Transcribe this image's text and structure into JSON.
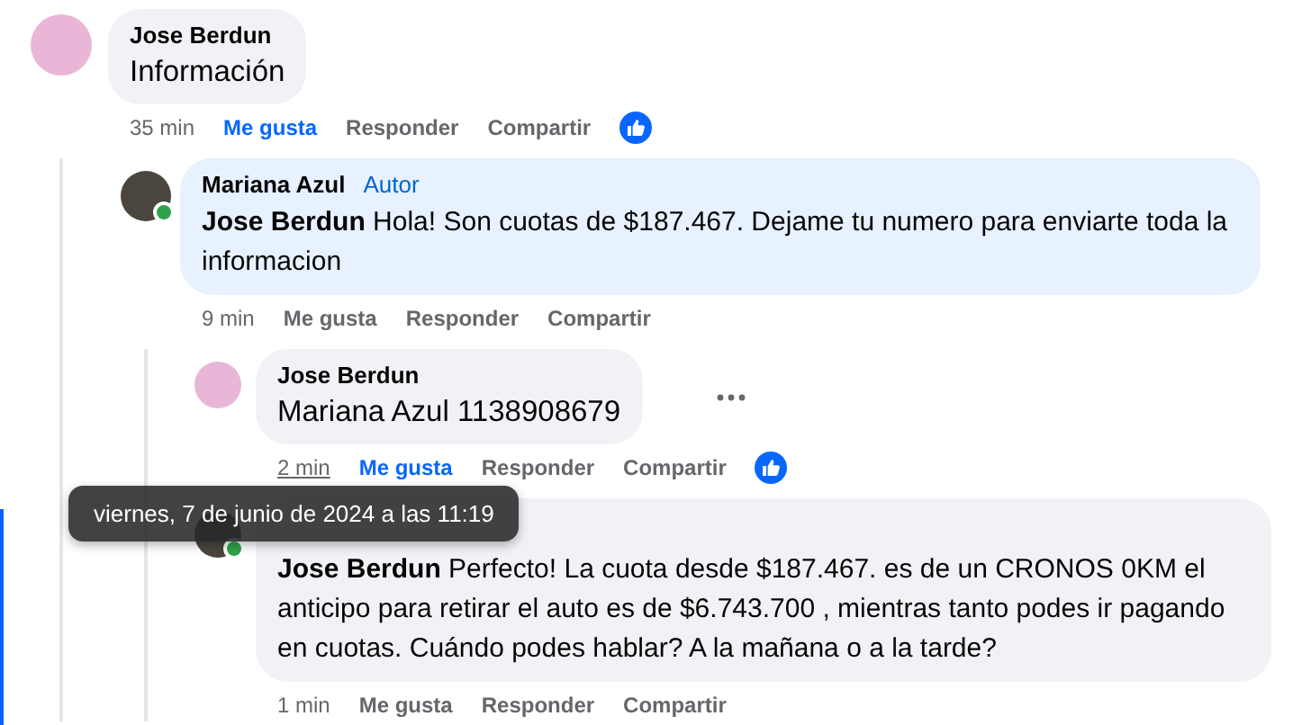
{
  "comments": [
    {
      "author": "Jose Berdun",
      "color": "#e9b6d8",
      "large_text": true,
      "text": "Información",
      "time": "35 min",
      "time_hovered": false,
      "liked": true,
      "actions": [
        "Me gusta",
        "Responder",
        "Compartir"
      ],
      "children": [
        {
          "author": "Mariana Azul",
          "badge": "Autor",
          "color": "#4a463f",
          "online": true,
          "large_text": false,
          "mention": "Jose Berdun",
          "text": "Hola! Son cuotas de $187.467. Dejame tu numero para enviarte toda la informacion",
          "time": "9 min",
          "time_hovered": false,
          "liked": false,
          "actions": [
            "Me gusta",
            "Responder",
            "Compartir"
          ],
          "children": [
            {
              "author": "Jose Berdun",
              "color": "#e9b6d8",
              "large_text": true,
              "mention": "Mariana Azul",
              "text": "1138908679",
              "time": "2 min",
              "time_hovered": true,
              "liked": true,
              "menu_visible": true,
              "actions": [
                "Me gusta",
                "Responder",
                "Compartir"
              ]
            },
            {
              "color": "#4a463f",
              "online": true,
              "large_text": false,
              "mention": "Jose Berdun",
              "text": "Perfecto! La cuota desde $187.467. es de un CRONOS 0KM el anticipo para retirar el auto es de $6.743.700 , mientras tanto podes ir pagando en cuotas. Cuándo podes hablar? A la mañana o a la tarde?",
              "time": "1 min",
              "time_hovered": false,
              "liked": false,
              "actions": [
                "Me gusta",
                "Responder",
                "Compartir"
              ]
            }
          ]
        }
      ]
    }
  ],
  "tooltip": {
    "text": "viernes, 7 de junio de 2024 a las 11:19"
  }
}
